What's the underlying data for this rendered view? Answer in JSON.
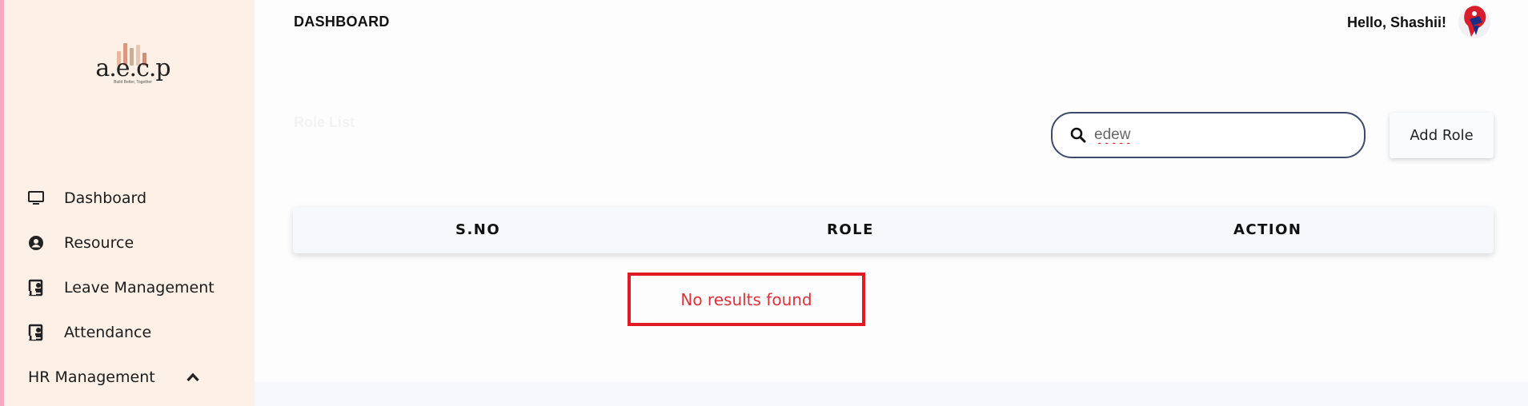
{
  "brand": {
    "logo_text": "a.e.c.p",
    "tagline": "Build Better, Together",
    "bar_colors": [
      "#e8b79c",
      "#d89a7e",
      "#c9ad95",
      "#e7c7b2",
      "#cf8f74"
    ]
  },
  "sidebar": {
    "items": [
      {
        "label": "Dashboard",
        "icon": "monitor-icon"
      },
      {
        "label": "Resource",
        "icon": "user-circle-icon"
      },
      {
        "label": "Leave Management",
        "icon": "contact-book-icon"
      },
      {
        "label": "Attendance",
        "icon": "contact-book-icon"
      }
    ],
    "group": {
      "label": "HR Management",
      "icon": "chevron-up-icon",
      "expanded": true
    }
  },
  "header": {
    "title": "DASHBOARD",
    "greeting": "Hello, Shashii!"
  },
  "section": {
    "title": "Role List"
  },
  "search": {
    "value": "edew",
    "placeholder": "Search"
  },
  "toolbar": {
    "add_label": "Add Role"
  },
  "table": {
    "columns": [
      "S.NO",
      "ROLE",
      "ACTION"
    ],
    "rows": [],
    "empty_message": "No results found"
  },
  "colors": {
    "sidebar_bg": "#fdf0e6",
    "accent_border": "#3d4a6e",
    "error": "#e01b24"
  }
}
